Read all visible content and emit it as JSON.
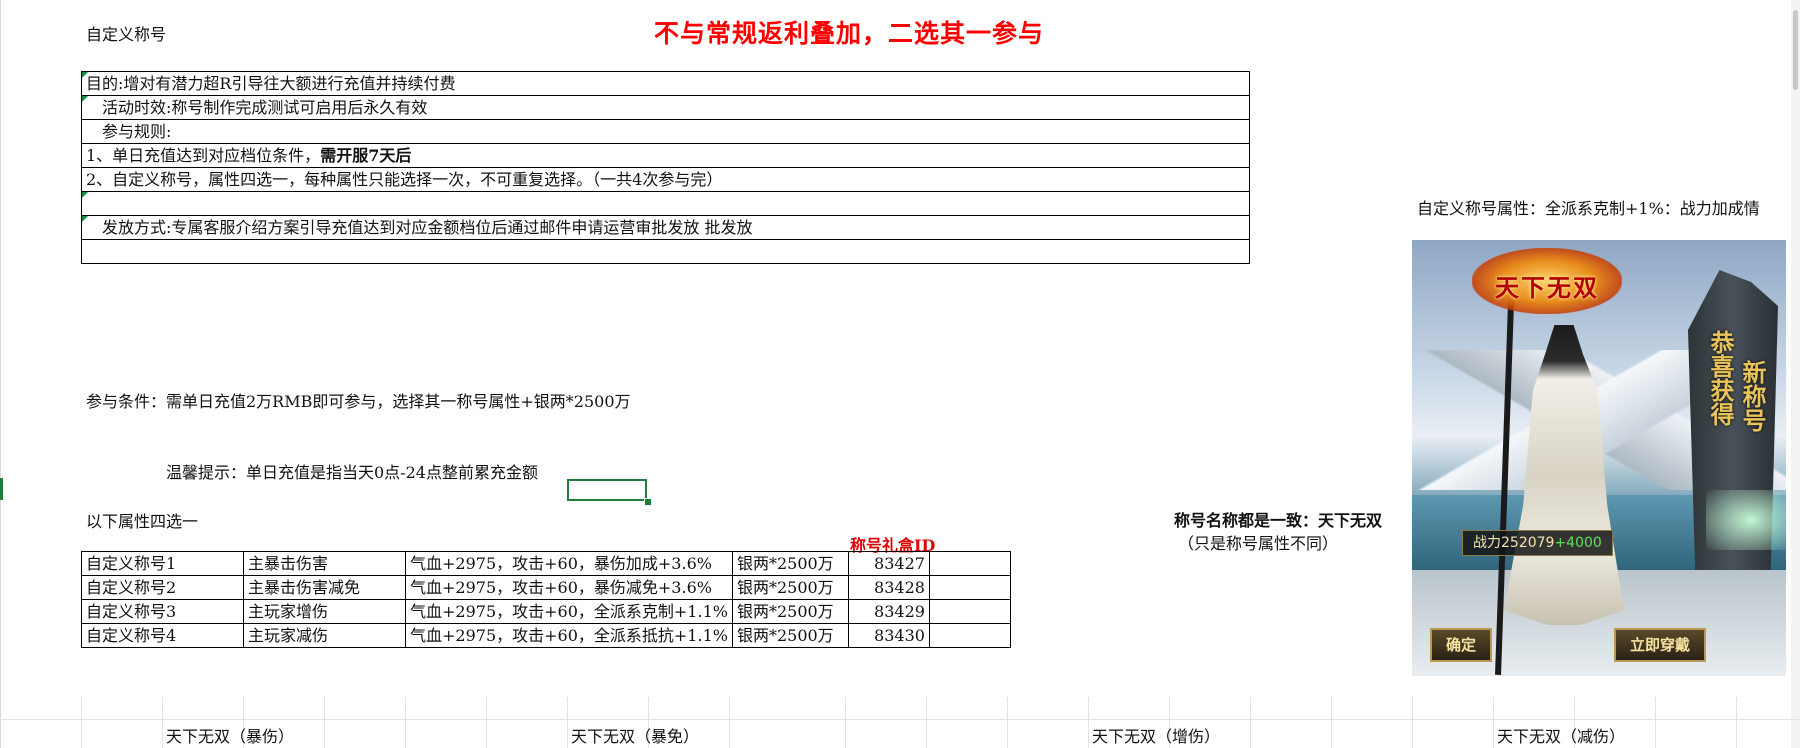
{
  "header": {
    "sheet_title": "自定义称号",
    "banner": "不与常规返利叠加，二选其一参与"
  },
  "rules": {
    "rows": [
      "目的:增对有潜力超R引导往大额进行充值并持续付费",
      "   活动时效:称号制作完成测试可启用后永久有效",
      "   参与规则:",
      "1、单日充值达到对应档位条件，",
      "2、自定义称号，属性四选一，每种属性只能选择一次，不可重复选择。（一共4次参与完）",
      "",
      "   发放方式:专属客服介绍方案引导充值达到对应金额档位后通过邮件申请运营审批发放 批发放",
      ""
    ],
    "rule1_bold": "需开服7天后"
  },
  "info": {
    "condition": "参与条件：需单日充值2万RMB即可参与，选择其一称号属性+银两*2500万",
    "tip": "温馨提示：单日充值是指当天0点-24点整前累充金额",
    "choose": "以下属性四选一",
    "gift_id_header": "称号礼盒ID",
    "right_attr": "自定义称号属性：全派系克制+1%：战力加成情",
    "name_note": "称号名称都是一致：天下无双",
    "name_note2": "（只是称号属性不同）"
  },
  "attr_table": {
    "rows": [
      {
        "name": "自定义称号1",
        "type": "主暴击伤害",
        "attr": "气血+2975，攻击+60，暴伤加成+3.6%",
        "silver": "银两*2500万",
        "id": "83427"
      },
      {
        "name": "自定义称号2",
        "type": "主暴击伤害减免",
        "attr": "气血+2975，攻击+60，暴伤减免+3.6%",
        "silver": "银两*2500万",
        "id": "83428"
      },
      {
        "name": "自定义称号3",
        "type": "主玩家增伤",
        "attr": "气血+2975，攻击+60，全派系克制+1.1%",
        "silver": "银两*2500万",
        "id": "83429"
      },
      {
        "name": "自定义称号4",
        "type": "主玩家减伤",
        "attr": "气血+2975，攻击+60，全派系抵抗+1.1%",
        "silver": "银两*2500万",
        "id": "83430"
      }
    ]
  },
  "bottom_labels": [
    "天下无双（暴伤）",
    "天下无双（暴免）",
    "天下无双（增伤）",
    "天下无双（减伤）"
  ],
  "game_image": {
    "emblem_text": "天下无双",
    "rock_text_1": "恭喜获得",
    "rock_text_2": "新称号",
    "power_label": "战力",
    "power_value": "252079",
    "power_plus": "+4000",
    "confirm_button": "确定",
    "wear_button": "立即穿戴"
  },
  "colors": {
    "banner_red": "#ff0000",
    "selection_green": "#1e7d3b"
  }
}
